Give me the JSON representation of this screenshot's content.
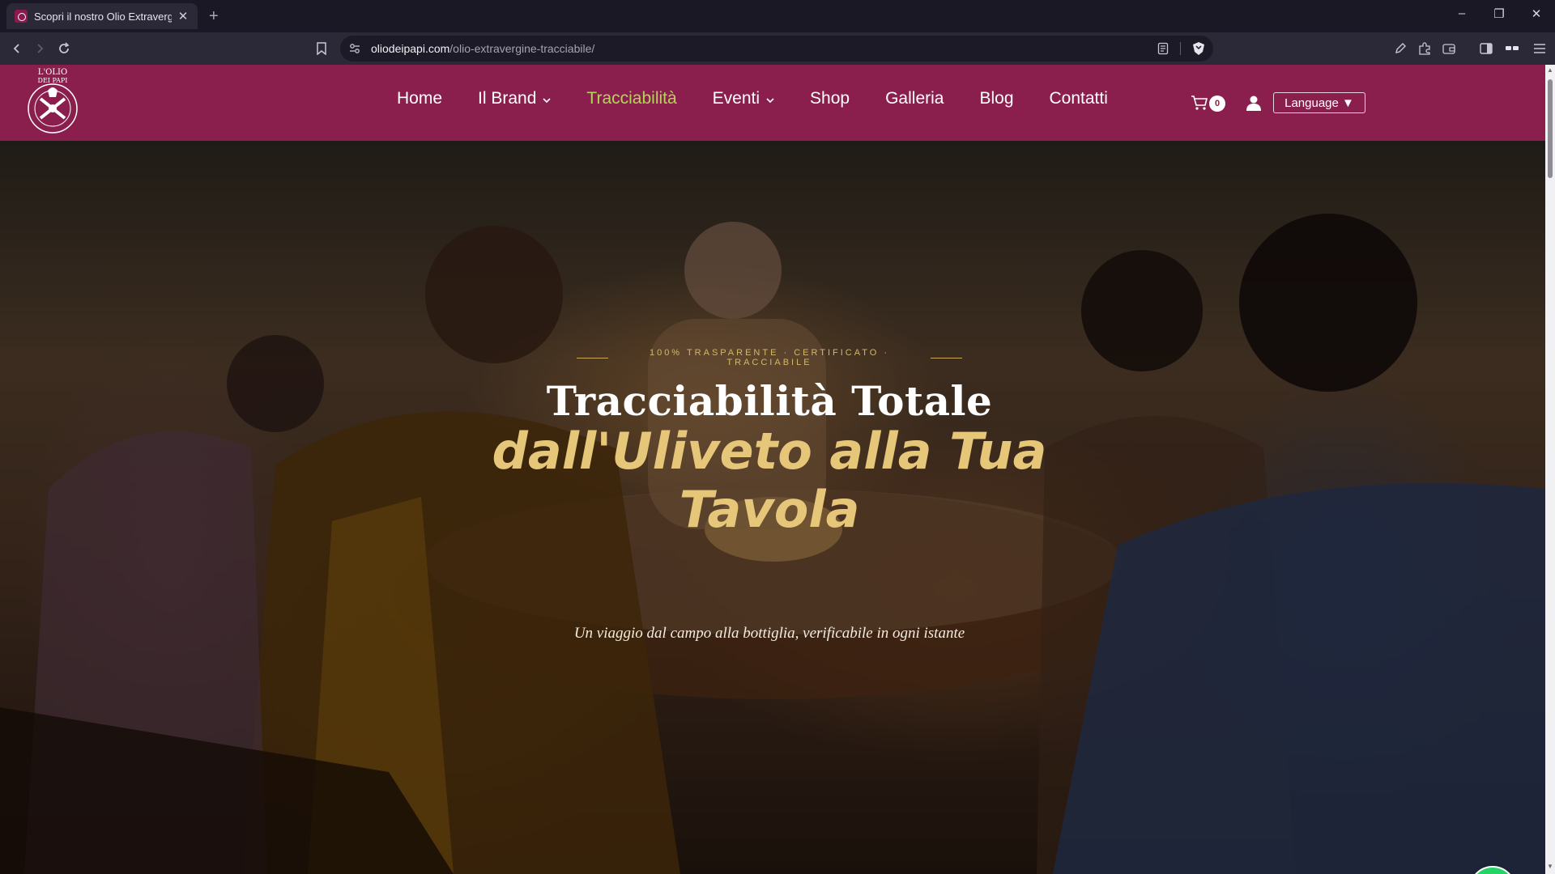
{
  "browser": {
    "tab": {
      "title": "Scopri il nostro Olio Extravergine"
    },
    "url": {
      "domain": "oliodeipapi.com",
      "path": "/olio-extravergine-tracciabile/"
    },
    "window_controls": {
      "minimize": "–",
      "restore": "❐",
      "close": "✕"
    },
    "new_tab": "+"
  },
  "site": {
    "brand": "L'Olio dei Papi",
    "nav": {
      "items": [
        {
          "label": "Home"
        },
        {
          "label": "Il Brand"
        },
        {
          "label": "Tracciabilità"
        },
        {
          "label": "Eventi"
        },
        {
          "label": "Shop"
        },
        {
          "label": "Galleria"
        },
        {
          "label": "Blog"
        },
        {
          "label": "Contatti"
        }
      ],
      "active": "Tracciabilità"
    },
    "cart_count": "0",
    "language_button": "Language ▼"
  },
  "hero": {
    "eyebrow": "100% TRASPARENTE · CERTIFICATO · TRACCIABILE",
    "title_line1": "Tracciabilità Totale",
    "title_line2": "dall'Uliveto alla Tua Tavola",
    "subtitle": "Un viaggio dal campo alla bottiglia, verificabile in ogni istante"
  },
  "colors": {
    "header_bg": "#8a1f4e",
    "nav_active": "#b5d35a",
    "accent_gold": "#e6c77a",
    "whatsapp": "#25d366"
  },
  "icons": [
    "back-icon",
    "forward-icon",
    "reload-icon",
    "bookmark-icon",
    "site-settings-icon",
    "reader-icon",
    "shield-icon",
    "pen-icon",
    "extensions-icon",
    "wallet-icon",
    "sidebar-icon",
    "vpn-icon",
    "menu-icon",
    "cart-icon",
    "user-icon",
    "whatsapp-icon",
    "chevron-down-icon"
  ]
}
